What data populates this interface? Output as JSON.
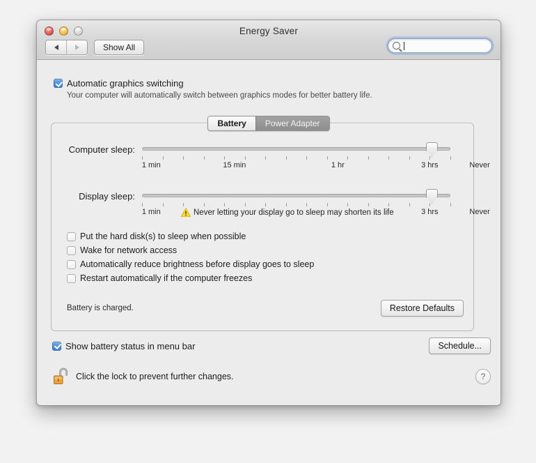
{
  "window": {
    "title": "Energy Saver",
    "traffic_lights": [
      "close",
      "minimize",
      "zoom"
    ]
  },
  "toolbar": {
    "back_icon": "back-arrow-icon",
    "forward_icon": "forward-arrow-icon",
    "show_all_label": "Show All",
    "search": {
      "icon": "search-icon",
      "value": "",
      "placeholder": ""
    }
  },
  "graphics": {
    "checkbox_label": "Automatic graphics switching",
    "checked": true,
    "description": "Your computer will automatically switch between graphics modes for better battery life."
  },
  "tabs": [
    {
      "label": "Battery",
      "active": true
    },
    {
      "label": "Power Adapter",
      "active": false
    }
  ],
  "sliders": [
    {
      "label": "Computer sleep:",
      "value": "Never",
      "tick_labels": [
        "1 min",
        "15 min",
        "1 hr",
        "3 hrs",
        "Never"
      ],
      "tick_count": 16
    },
    {
      "label": "Display sleep:",
      "value": "Never",
      "tick_labels": [
        "1 min",
        "15 min",
        "1 hr",
        "3 hrs",
        "Never"
      ],
      "tick_count": 16,
      "warning": {
        "icon": "warning-triangle-icon",
        "text": "Never letting your display go to sleep may shorten its life",
        "color": "#f5d32c"
      }
    }
  ],
  "options": [
    {
      "label": "Put the hard disk(s) to sleep when possible",
      "checked": false
    },
    {
      "label": "Wake for network access",
      "checked": false
    },
    {
      "label": "Automatically reduce brightness before display goes to sleep",
      "checked": false
    },
    {
      "label": "Restart automatically if the computer freezes",
      "checked": false
    }
  ],
  "status": {
    "battery_text": "Battery is charged.",
    "restore_defaults_label": "Restore Defaults"
  },
  "footer": {
    "menu_bar_checkbox_label": "Show battery status in menu bar",
    "menu_bar_checked": true,
    "schedule_label": "Schedule...",
    "lock_icon": "unlocked-padlock-icon",
    "lock_text": "Click the lock to prevent further changes.",
    "help_label": "?"
  },
  "colors": {
    "accent": "#3c7fd0",
    "warning": "#f5d32c",
    "lock_body": "#e8a33d",
    "window_bg": "#ececec"
  }
}
